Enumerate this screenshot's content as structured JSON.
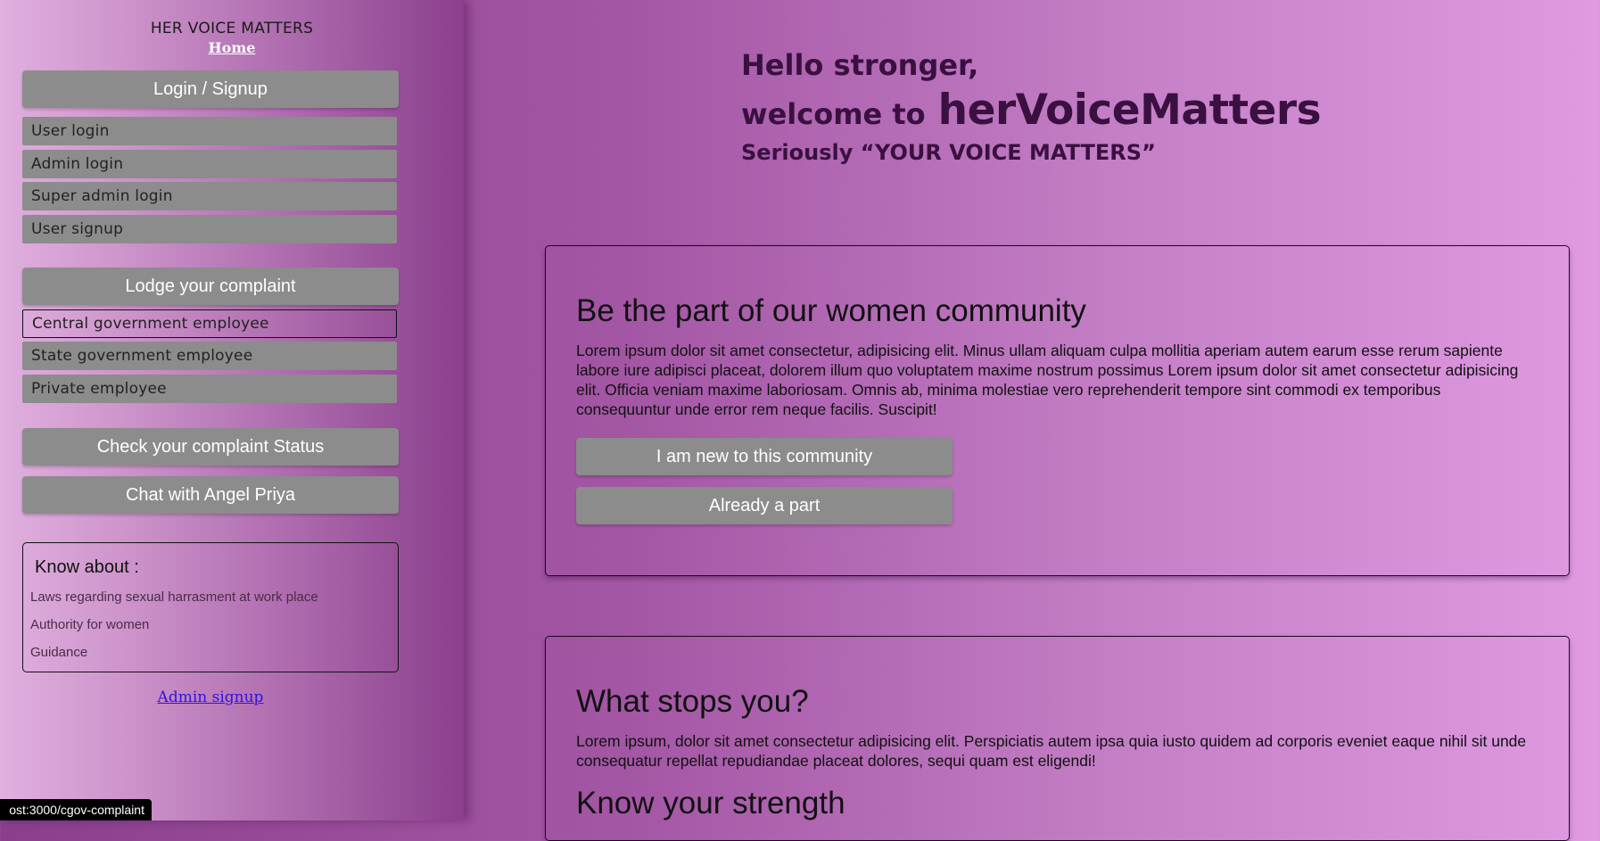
{
  "sidebar": {
    "brand": "HER VOICE MATTERS",
    "home": "Home",
    "login_section": "Login / Signup",
    "login_items": [
      "User login",
      "Admin login",
      "Super admin login",
      "User signup"
    ],
    "complaint_section": "Lodge your complaint",
    "complaint_items": [
      "Central government employee",
      "State government employee",
      "Private employee"
    ],
    "check_status": "Check your complaint Status",
    "chat": "Chat with Angel Priya",
    "know_title": "Know about :",
    "know_links": [
      "Laws regarding sexual harrasment at work place",
      "Authority for women",
      "Guidance"
    ],
    "admin_signup": "Admin signup"
  },
  "hero": {
    "line1": "Hello stronger,",
    "welcome": "welcome to",
    "brand": "herVoiceMatters",
    "line3": "Seriously “YOUR VOICE MATTERS”"
  },
  "card1": {
    "title": "Be the part of our women community",
    "text": "Lorem ipsum dolor sit amet consectetur, adipisicing elit. Minus ullam aliquam culpa mollitia aperiam autem earum esse rerum sapiente labore iure adipisci placeat, dolorem illum quo voluptatem maxime nostrum possimus Lorem ipsum dolor sit amet consectetur adipisicing elit. Officia veniam maxime laboriosam. Omnis ab, minima molestiae vero reprehenderit tempore sint commodi ex temporibus consequuntur unde error rem neque facilis. Suscipit!",
    "btn_new": "I am new to this community",
    "btn_part": "Already a part"
  },
  "card2": {
    "title": "What stops you?",
    "text": "Lorem ipsum, dolor sit amet consectetur adipisicing elit. Perspiciatis autem ipsa quia iusto quidem ad corporis eveniet eaque nihil sit unde consequatur repellat repudiandae placeat dolores, sequi quam est eligendi!",
    "title2": "Know your strength"
  },
  "status_bar": {
    "url": "ost:3000/cgov-complaint"
  }
}
